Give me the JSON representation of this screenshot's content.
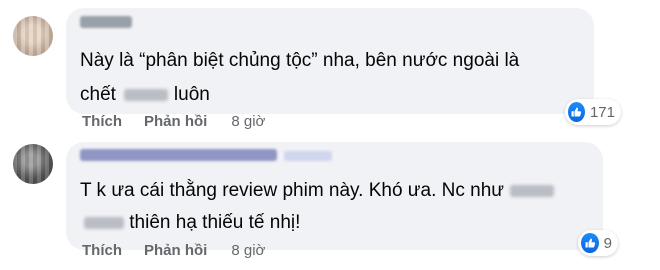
{
  "comments": [
    {
      "line1": "Này là “phân biệt chủng tộc” nha, bên nước ngoài là",
      "line2_before": "chết",
      "line2_after": "luôn",
      "reactions": "171",
      "actions": {
        "like": "Thích",
        "reply": "Phản hồi",
        "time": "8 giờ"
      }
    },
    {
      "line1_before": "T k ưa cái thằng review phim này. Khó ưa. Nc như",
      "line2_after": "thiên hạ thiếu tế nhị!",
      "reactions": "9",
      "actions": {
        "like": "Thích",
        "reply": "Phản hồi",
        "time": "8 giờ"
      }
    }
  ],
  "icons": {
    "reaction": "like-icon"
  },
  "colors": {
    "bubble": "#f0f2f5",
    "meta": "#65676b",
    "like_blue": "#1877f2"
  }
}
